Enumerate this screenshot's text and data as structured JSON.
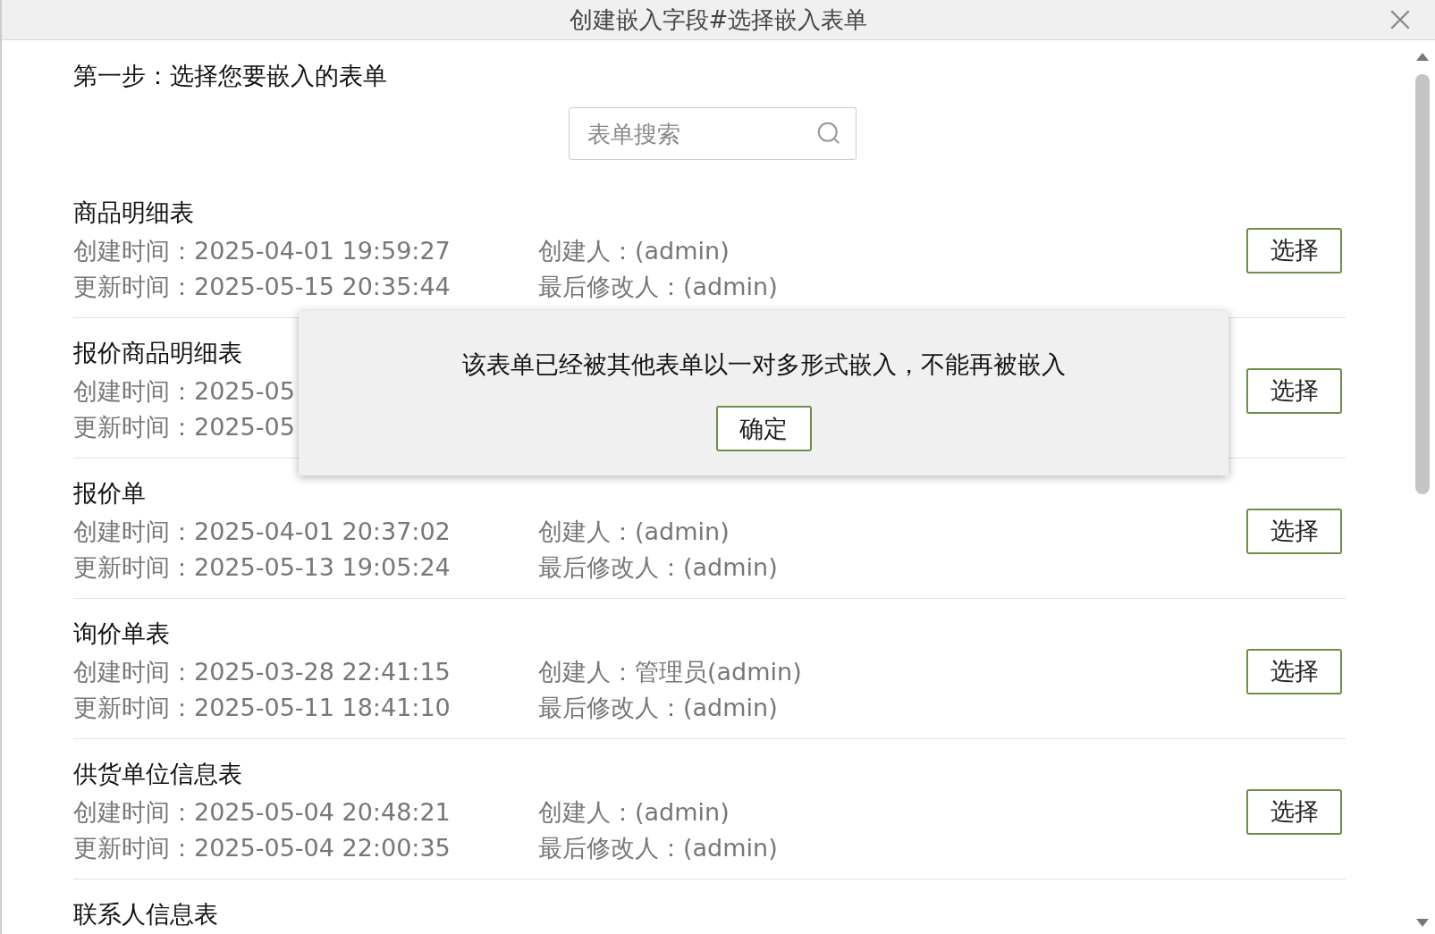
{
  "window": {
    "title": "创建嵌入字段#选择嵌入表单"
  },
  "step_label": "第一步：选择您要嵌入的表单",
  "search": {
    "placeholder": "表单搜索"
  },
  "forms": [
    {
      "title": "商品明细表",
      "created": "创建时间：2025-04-01 19:59:27",
      "creator": "创建人：(admin)",
      "updated": "更新时间：2025-05-15 20:35:44",
      "modifier": "最后修改人：(admin)",
      "button": "选择"
    },
    {
      "title": "报价商品明细表",
      "created": "创建时间：2025-05",
      "updated": "更新时间：2025-05",
      "button": "选择"
    },
    {
      "title": "报价单",
      "created": "创建时间：2025-04-01 20:37:02",
      "creator": "创建人：(admin)",
      "updated": "更新时间：2025-05-13 19:05:24",
      "modifier": "最后修改人：(admin)",
      "button": "选择"
    },
    {
      "title": "询价单表",
      "created": "创建时间：2025-03-28 22:41:15",
      "creator": "创建人：管理员(admin)",
      "updated": "更新时间：2025-05-11 18:41:10",
      "modifier": "最后修改人：(admin)",
      "button": "选择"
    },
    {
      "title": "供货单位信息表",
      "created": "创建时间：2025-05-04 20:48:21",
      "creator": "创建人：(admin)",
      "updated": "更新时间：2025-05-04 22:00:35",
      "modifier": "最后修改人：(admin)",
      "button": "选择"
    },
    {
      "title": "联系人信息表"
    }
  ],
  "dialog": {
    "message": "该表单已经被其他表单以一对多形式嵌入，不能再被嵌入",
    "button": "确定"
  }
}
